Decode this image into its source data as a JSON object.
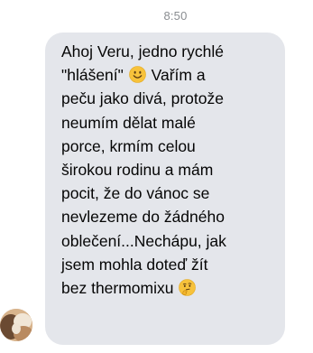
{
  "chat": {
    "timestamp": "8:50",
    "message": {
      "lines": [
        "Ahoj Veru, jedno rychlé",
        "\"hlášení\"",
        "Vařím a",
        "peču jako divá, protože",
        "neumím dělat malé",
        "porce, krmím celou",
        "širokou rodinu a mám",
        "pocit, že do vánoc se",
        "nevlezeme do žádného",
        "oblečení...Nechápu, jak",
        "jsem mohla doteď žít",
        "bez thermomixu"
      ],
      "emojis": [
        "smiling-face-icon",
        "thinking-face-icon"
      ]
    },
    "sender": {
      "avatar_icon": "avatar-icon"
    }
  }
}
